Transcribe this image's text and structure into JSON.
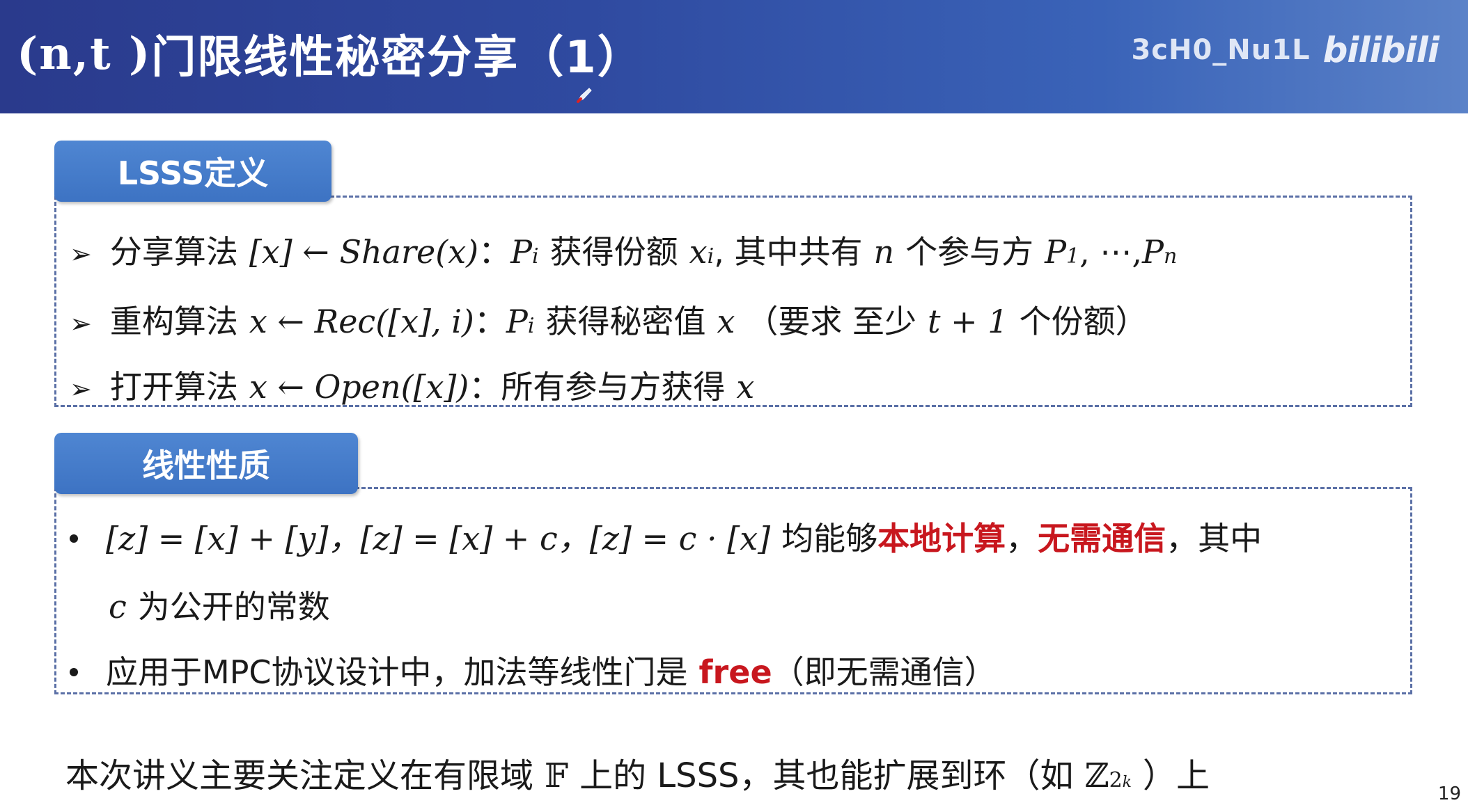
{
  "header": {
    "title_math": "(n,t )",
    "title_text": "门限线性秘密分享（1）",
    "watermark_text": "3cH0_Nu1L",
    "logo_text": "bilibili"
  },
  "section1": {
    "tab_label": "LSSS定义",
    "items": [
      {
        "label": "分享算法",
        "formula": "[x] ← Share(x)",
        "sep": "：",
        "party": "P",
        "party_sub": "i",
        "text1": "获得份额",
        "share_var": "x",
        "share_sup": "i",
        "text2": ", 其中共有",
        "n_var": "n",
        "text3": "个参与方",
        "p1": "P",
        "p1_sub": "1",
        "dots": ", ⋯,",
        "pn": "P",
        "pn_sub": "n"
      },
      {
        "label": "重构算法",
        "formula": "x ← Rec([x], i)",
        "sep": "：",
        "party": "P",
        "party_sub": "i",
        "text1": "获得秘密值",
        "var": "x",
        "text2": "（要求 至少",
        "expr": "t + 1",
        "text3": "个份额）"
      },
      {
        "label": "打开算法",
        "formula": "x ← Open([x])",
        "sep": "：",
        "text1": "所有参与方获得",
        "var": "x"
      }
    ]
  },
  "section2": {
    "tab_label": "线性性质",
    "items": [
      {
        "formula": "[z] = [x] + [y]，[z] = [x] + c，[z] = c · [x]",
        "text1": "均能够",
        "highlight1": "本地计算",
        "comma": "，",
        "highlight2": "无需通信",
        "text2": "，其中",
        "line2_var": "c",
        "line2_text": "为公开的常数"
      },
      {
        "text1": "应用于MPC协议设计中，加法等线性门是",
        "highlight": "free",
        "text2": "（即无需通信）"
      }
    ]
  },
  "footer": {
    "text1": "本次讲义主要关注定义在有限域",
    "field": "𝔽",
    "text2": "上的 LSSS，其也能扩展到环（如",
    "ring": "ℤ",
    "ring_sub": "2",
    "ring_sub_sup": "k",
    "text3": "）上"
  },
  "page_number": "19",
  "colors": {
    "header_start": "#2a3a8c",
    "header_end": "#5b82c8",
    "tab_blue": "#4a7fcc",
    "highlight_red": "#c8171e",
    "dashed_border": "#5b70a6"
  }
}
